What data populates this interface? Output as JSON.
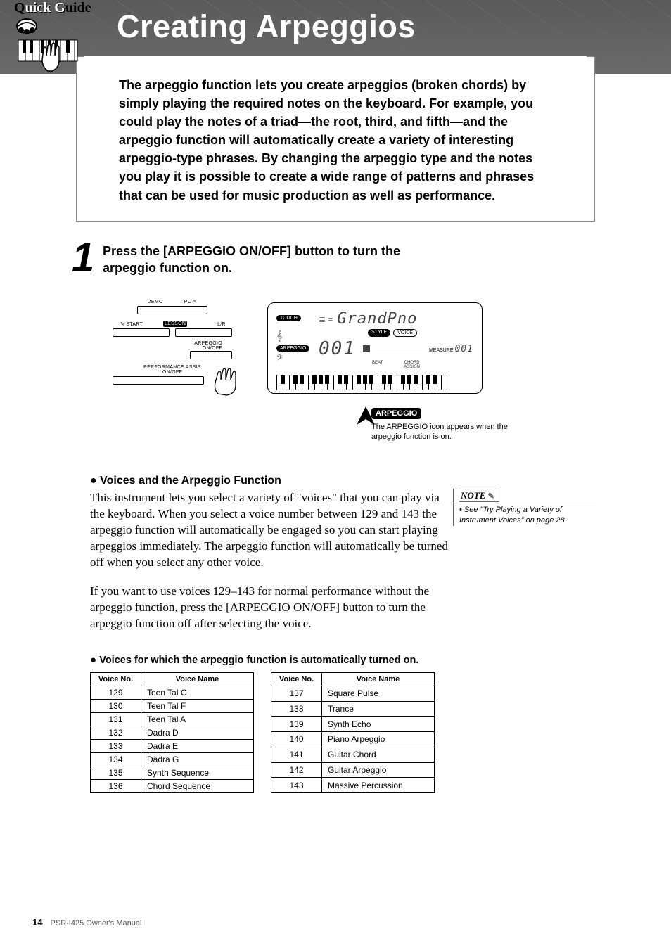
{
  "badge": {
    "text_a": "Q",
    "text_b": "uick G",
    "text_c": "uide"
  },
  "header": {
    "title": "Creating Arpeggios"
  },
  "intro": {
    "text": "The arpeggio function lets you create arpeggios (broken chords) by simply playing the required notes on the keyboard. For example, you could play the notes of a triad—the root, third, and fifth—and the arpeggio function will automatically create a variety of interesting arpeggio-type phrases. By changing the arpeggio type and the notes you play it is possible to create a wide range of patterns and phrases that can be used for music production as well as performance."
  },
  "step1": {
    "number": "1",
    "text": "Press the [ARPEGGIO ON/OFF] button to turn the arpeggio function on.",
    "panel": {
      "demo": "DEMO",
      "pc": "PC",
      "start": "START",
      "lesson": "LESSON",
      "lr": "L/R",
      "arpeggio": "ARPEGGIO\nON/OFF",
      "pat": "PERFORMANCE ASSIS\nON/OFF"
    },
    "lcd": {
      "touch": "TOUCH",
      "voice_name": "GrandPno",
      "style_pill": "STYLE",
      "voice_pill": "VOICE",
      "arpeggio_pill": "ARPEGGIO",
      "measure_label": "MEASURE",
      "measure_value": "001",
      "number": "001",
      "beat_label": "BEAT",
      "chord_label": "CHORD\nASSIGN"
    },
    "icon_label": "ARPEGGIO",
    "icon_caption": "The ARPEGGIO icon appears when the arpeggio function is on."
  },
  "section_voices": {
    "heading": "Voices and the Arpeggio Function",
    "body_a": "This instrument lets you select a variety of \"voices\" that you can play via the keyboard. When you select a voice number between 129 and 143 the arpeggio function will automatically be engaged so you can start playing arpeggios immediately. The arpeggio function will automatically be turned off when you select any other voice.",
    "body_b": "If you want to use voices 129–143 for normal performance without the arpeggio function, press the [ARPEGGIO ON/OFF] button to turn the arpeggio function off after selecting the voice."
  },
  "note": {
    "label": "NOTE",
    "text": "• See \"Try Playing a Variety of Instrument Voices\" on page 28."
  },
  "tables": {
    "title": "Voices for which the arpeggio function is automatically turned on.",
    "head_no": "Voice No.",
    "head_name": "Voice Name",
    "left": [
      {
        "no": "129",
        "name": "Teen Tal C"
      },
      {
        "no": "130",
        "name": "Teen Tal F"
      },
      {
        "no": "131",
        "name": "Teen Tal A"
      },
      {
        "no": "132",
        "name": "Dadra D"
      },
      {
        "no": "133",
        "name": "Dadra E"
      },
      {
        "no": "134",
        "name": "Dadra G"
      },
      {
        "no": "135",
        "name": "Synth Sequence"
      },
      {
        "no": "136",
        "name": "Chord Sequence"
      }
    ],
    "right": [
      {
        "no": "137",
        "name": "Square Pulse"
      },
      {
        "no": "138",
        "name": "Trance"
      },
      {
        "no": "139",
        "name": "Synth Echo"
      },
      {
        "no": "140",
        "name": "Piano Arpeggio"
      },
      {
        "no": "141",
        "name": "Guitar Chord"
      },
      {
        "no": "142",
        "name": "Guitar Arpeggio"
      },
      {
        "no": "143",
        "name": "Massive Percussion"
      }
    ]
  },
  "footer": {
    "page": "14",
    "doc": "PSR-I425  Owner's Manual"
  }
}
